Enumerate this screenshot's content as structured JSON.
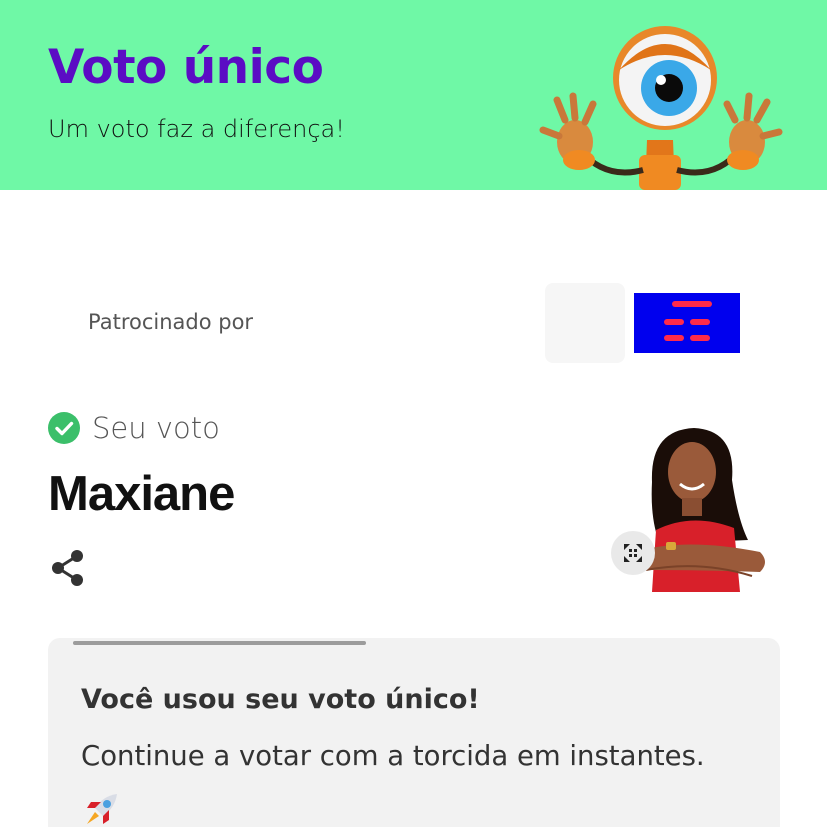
{
  "header": {
    "title": "Voto único",
    "subtitle": "Um voto faz a diferença!",
    "background_color": "#6ff8a6",
    "title_color": "#5b0cc4",
    "mascot_icon": "big-brother-eye-mascot"
  },
  "sponsor": {
    "label": "Patrocinado por",
    "logo_color": "#0000ee",
    "logo_icon": "sponsor-logo"
  },
  "vote": {
    "status_label": "Seu voto",
    "status_icon": "check-circle-icon",
    "status_color": "#3bbf6a",
    "candidate_name": "Maxiane",
    "share_icon": "share-icon",
    "expand_icon": "expand-icon"
  },
  "card": {
    "title": "Você usou seu voto único!",
    "message": "Continue a votar com a torcida em instantes.",
    "emoji_icon": "rocket-icon"
  }
}
